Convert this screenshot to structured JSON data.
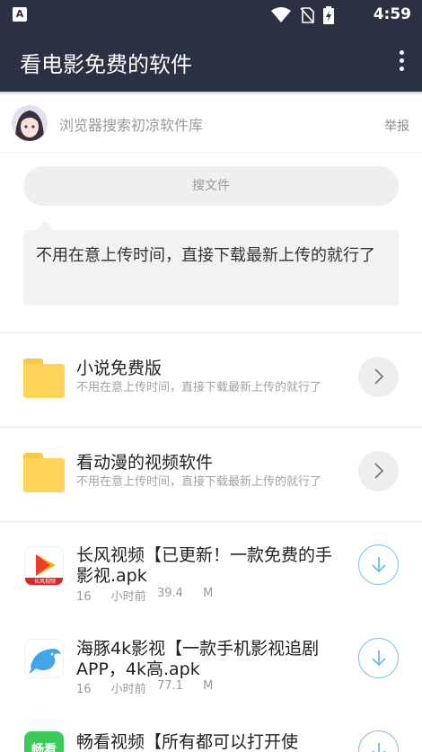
{
  "status_bar": {
    "time": "4:59",
    "left_icon_letter": "A",
    "icons": [
      "wifi-icon",
      "no-sim-icon",
      "battery-charging-icon"
    ]
  },
  "app_bar": {
    "title": "看电影免费的软件",
    "menu_icon": "more-vert-icon"
  },
  "user": {
    "name": "浏览器搜索初凉软件库",
    "report_label": "举报"
  },
  "search": {
    "placeholder": "搜文件"
  },
  "message": {
    "text": "不用在意上传时间，直接下载最新上传的就行了"
  },
  "folders": [
    {
      "title": "小说免费版",
      "subtitle": "不用在意上传时间，直接下载最新上传的就行了",
      "action_icon": "chevron-right-icon"
    },
    {
      "title": "看动漫的视频软件",
      "subtitle": "不用在意上传时间，直接下载最新上传的就行了",
      "action_icon": "chevron-right-icon"
    }
  ],
  "files": [
    {
      "title_line1": "长风视频【已更新！一款免费的手",
      "title_line2": "影视.apk",
      "time": "16 小时前",
      "size": "39.4 M",
      "icon": "changfeng-app-icon",
      "icon_caption": "长风视频",
      "action_icon": "download-icon"
    },
    {
      "title_line1": "海豚4k影视【一款手机影视追剧",
      "title_line2": "APP，4k高.apk",
      "time": "16 小时前",
      "size": "77.1 M",
      "icon": "dolphin-app-icon",
      "action_icon": "download-icon"
    },
    {
      "title_line1": "畅看视频【所有都可以打开使",
      "title_line2": "",
      "time": "",
      "size": "",
      "icon": "changkan-app-icon",
      "icon_caption": "畅看",
      "action_icon": "download-icon"
    }
  ],
  "colors": {
    "app_bar": "#2b3042",
    "folder": "#ffd45a",
    "download_accent": "#7cc4ea"
  }
}
